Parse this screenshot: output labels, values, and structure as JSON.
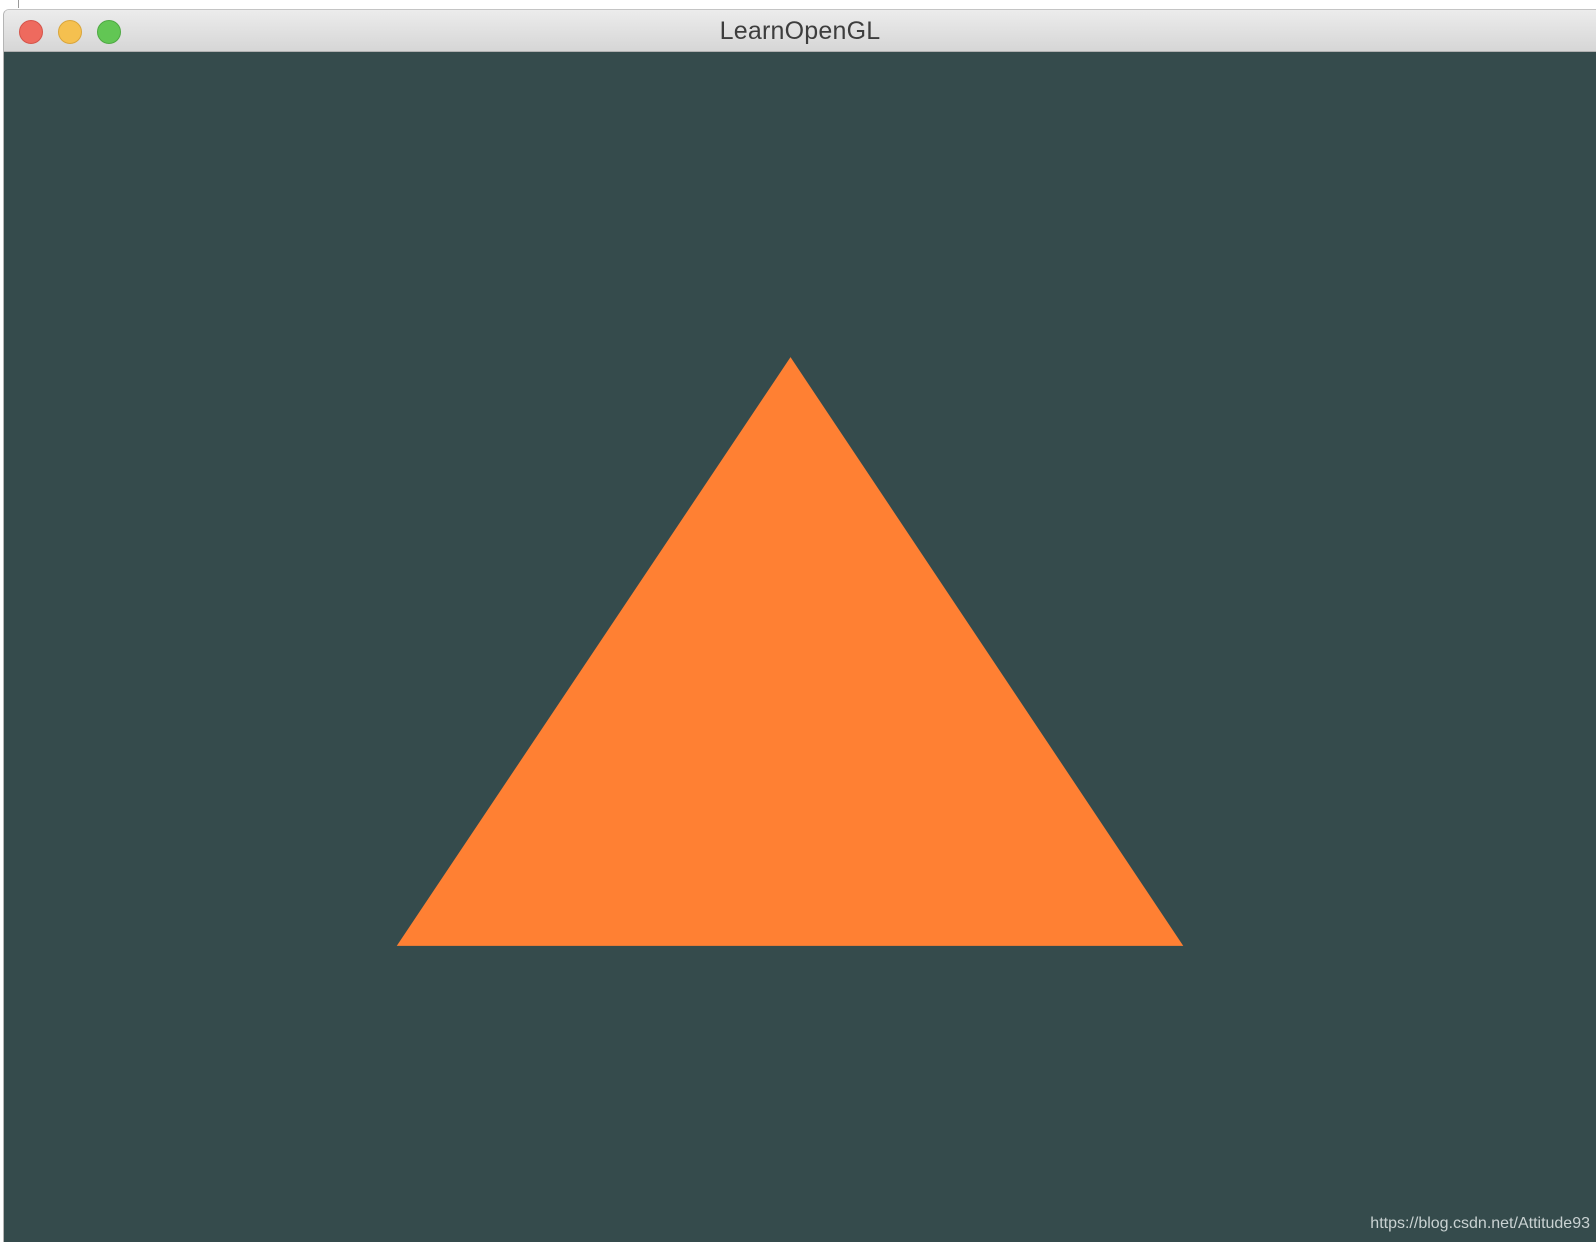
{
  "window": {
    "title": "LearnOpenGL",
    "controls": {
      "close": "close-button",
      "minimize": "minimize-button",
      "zoom": "zoom-button"
    }
  },
  "scene": {
    "clear_color": "#354b4c",
    "triangle_color": "#ff8033"
  },
  "watermark": "https://blog.csdn.net/Attitude93"
}
